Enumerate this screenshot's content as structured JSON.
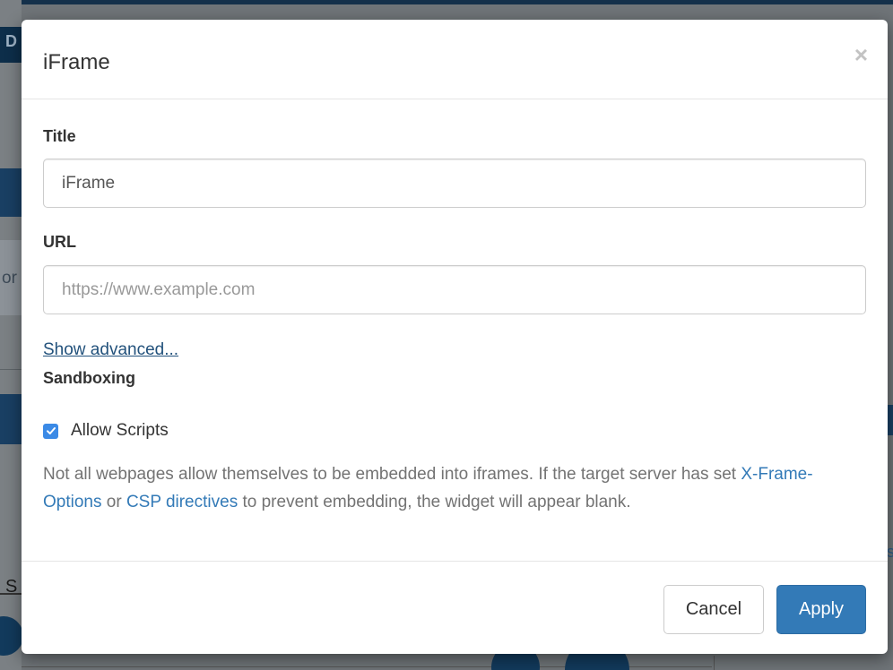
{
  "background": {
    "left_header_text": "D",
    "left_fragment_text": "or",
    "left_letter_s": "S",
    "right_fragment_s": "s"
  },
  "modal": {
    "title": "iFrame",
    "close_symbol": "×",
    "fields": {
      "title_label": "Title",
      "title_value": "iFrame",
      "url_label": "URL",
      "url_value": "",
      "url_placeholder": "https://www.example.com"
    },
    "show_advanced_label": "Show advanced...",
    "sandboxing_label": "Sandboxing",
    "allow_scripts": {
      "label": "Allow Scripts",
      "checked": true
    },
    "help": {
      "part1": "Not all webpages allow themselves to be embedded into iframes. If the target server has set ",
      "link1": "X-Frame-Options",
      "part2": " or ",
      "link2": "CSP directives",
      "part3": " to prevent embedding, the widget will appear blank."
    },
    "footer": {
      "cancel_label": "Cancel",
      "apply_label": "Apply"
    }
  },
  "colors": {
    "primary": "#337ab7",
    "link": "#23527c",
    "checkbox": "#3b8ae6",
    "overlay_bg": "#6f7478"
  },
  "icons": {
    "close": "close-icon",
    "checkbox_check": "checkmark-icon"
  }
}
